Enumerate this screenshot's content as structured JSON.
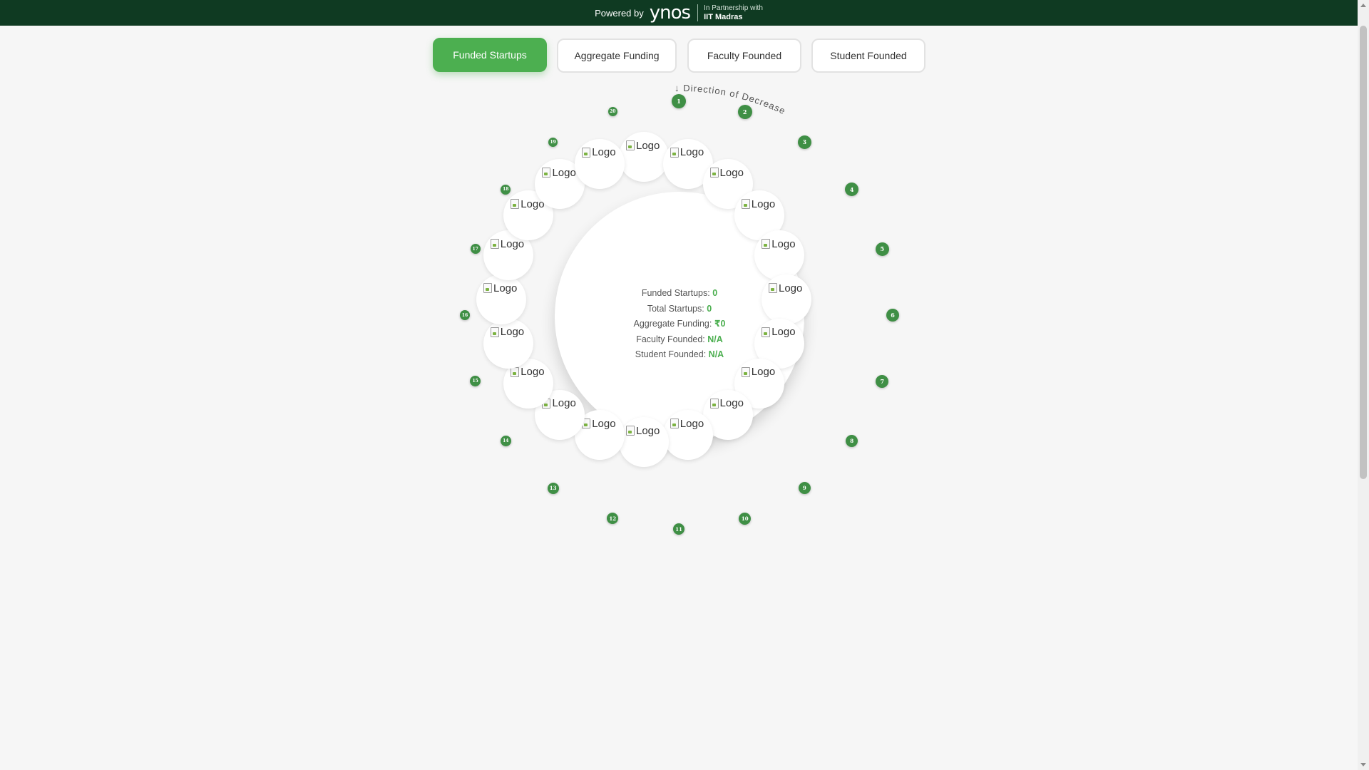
{
  "header": {
    "powered_by": "Powered by",
    "brand": "ynos",
    "partner_line1": "In Partnership with",
    "partner_line2": "IIT Madras"
  },
  "tabs": [
    {
      "label": "Funded Startups",
      "active": true
    },
    {
      "label": "Aggregate Funding",
      "active": false
    },
    {
      "label": "Faculty Founded",
      "active": false
    },
    {
      "label": "Student Founded",
      "active": false
    }
  ],
  "arc_label": "↓ Direction of Decrease →",
  "stats": {
    "funded_label": "Funded Startups:",
    "funded_value": "0",
    "total_label": "Total Startups:",
    "total_value": "0",
    "aggregate_label": "Aggregate Funding:",
    "aggregate_value": "₹0",
    "faculty_label": "Faculty Founded:",
    "faculty_value": "N/A",
    "student_label": "Student Founded:",
    "student_value": "N/A"
  },
  "logo_alt": "Logo",
  "logo_count": 20,
  "ranks": [
    "1",
    "2",
    "3",
    "4",
    "5",
    "6",
    "7",
    "8",
    "9",
    "10",
    "11",
    "12",
    "13",
    "14",
    "15",
    "16",
    "17",
    "18",
    "19",
    "20"
  ],
  "colors": {
    "accent": "#4caf50",
    "topbar": "#0f3a22",
    "rank_dot": "#3f8f45"
  }
}
